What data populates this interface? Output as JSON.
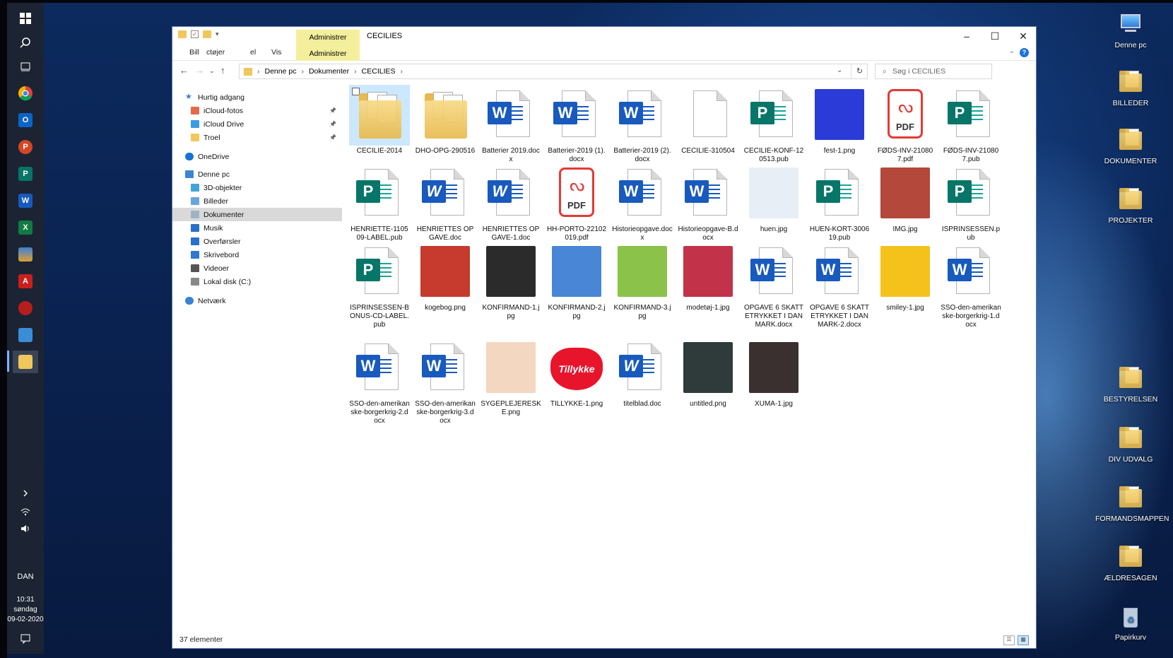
{
  "window": {
    "title": "CECILIES",
    "context_tab_top": "Administrer",
    "context_tab_bottom": "Administrer",
    "ribbon_tabs": [
      "Bill",
      "ctøjer",
      "el",
      "Vis"
    ]
  },
  "address": {
    "path": [
      "Denne pc",
      "Dokumenter",
      "CECILIES"
    ],
    "search_placeholder": "Søg i CECILIES"
  },
  "navpane": {
    "items": [
      {
        "label": "Hurtig adgang",
        "icon": "star-icon",
        "pinned": false
      },
      {
        "label": "iCloud-fotos",
        "icon": "icloud-photos-icon",
        "pinned": true
      },
      {
        "label": "iCloud Drive",
        "icon": "icloud-drive-icon",
        "pinned": true
      },
      {
        "label": "Troel",
        "icon": "folder-icon",
        "pinned": true
      },
      {
        "label": "OneDrive",
        "icon": "onedrive-icon",
        "pinned": false
      },
      {
        "label": "Denne pc",
        "icon": "computer-icon",
        "pinned": false
      },
      {
        "label": "3D-objekter",
        "icon": "cube-icon",
        "pinned": false
      },
      {
        "label": "Billeder",
        "icon": "pictures-icon",
        "pinned": false
      },
      {
        "label": "Dokumenter",
        "icon": "documents-icon",
        "pinned": false,
        "selected": true
      },
      {
        "label": "Musik",
        "icon": "music-icon",
        "pinned": false
      },
      {
        "label": "Overførsler",
        "icon": "download-icon",
        "pinned": false
      },
      {
        "label": "Skrivebord",
        "icon": "desktop-icon",
        "pinned": false
      },
      {
        "label": "Videoer",
        "icon": "video-icon",
        "pinned": false
      },
      {
        "label": "Lokal disk (C:)",
        "icon": "disk-icon",
        "pinned": false
      },
      {
        "label": "Netværk",
        "icon": "network-icon",
        "pinned": false
      }
    ]
  },
  "files": [
    {
      "name": "CECILIE-2014",
      "type": "folder",
      "selected": true
    },
    {
      "name": "DHO-OPG-290516",
      "type": "folder"
    },
    {
      "name": "Batterier 2019.docx",
      "type": "word"
    },
    {
      "name": "Batterier-2019 (1).docx",
      "type": "word"
    },
    {
      "name": "Batterier-2019 (2).docx",
      "type": "word"
    },
    {
      "name": "CECILIE-310504",
      "type": "blank"
    },
    {
      "name": "CECILIE-KONF-120513.pub",
      "type": "pub"
    },
    {
      "name": "fest-1.png",
      "type": "image",
      "color": "#2a3bd8"
    },
    {
      "name": "FØDS-INV-210807.pdf",
      "type": "pdf"
    },
    {
      "name": "FØDS-INV-210807.pub",
      "type": "pub"
    },
    {
      "name": "HENRIETTE-110509-LABEL.pub",
      "type": "pub"
    },
    {
      "name": "HENRIETTES OPGAVE.doc",
      "type": "word-old"
    },
    {
      "name": "HENRIETTES OPGAVE-1.doc",
      "type": "word-old"
    },
    {
      "name": "HH-PORTO-22102019.pdf",
      "type": "pdf"
    },
    {
      "name": "Historieopgave.docx",
      "type": "word"
    },
    {
      "name": "Historieopgave-B.docx",
      "type": "word"
    },
    {
      "name": "huen.jpg",
      "type": "image",
      "color": "#e8eef5"
    },
    {
      "name": "HUEN-KORT-300619.pub",
      "type": "pub"
    },
    {
      "name": "IMG.jpg",
      "type": "image",
      "color": "#b4483a"
    },
    {
      "name": "ISPRINSESSEN.pub",
      "type": "pub"
    },
    {
      "name": "ISPRINSESSEN-BONUS-CD-LABEL.pub",
      "type": "pub"
    },
    {
      "name": "kogebog.png",
      "type": "image",
      "color": "#c73a2e"
    },
    {
      "name": "KONFIRMAND-1.jpg",
      "type": "image",
      "color": "#2b2b2b"
    },
    {
      "name": "KONFIRMAND-2.jpg",
      "type": "image",
      "color": "#4a86d6"
    },
    {
      "name": "KONFIRMAND-3.jpg",
      "type": "image",
      "color": "#8ac24a"
    },
    {
      "name": "modetøj-1.jpg",
      "type": "image",
      "color": "#c2334a"
    },
    {
      "name": "OPGAVE 6 SKATTETRYKKET I DANMARK.docx",
      "type": "word"
    },
    {
      "name": "OPGAVE 6 SKATTETRYKKET I DANMARK-2.docx",
      "type": "word"
    },
    {
      "name": "smiley-1.jpg",
      "type": "image",
      "color": "#f5c21b"
    },
    {
      "name": "SSO-den-amerikanske-borgerkrig-1.docx",
      "type": "word"
    },
    {
      "name": "SSO-den-amerikanske-borgerkrig-2.docx",
      "type": "word"
    },
    {
      "name": "SSO-den-amerikanske-borgerkrig-3.docx",
      "type": "word"
    },
    {
      "name": "SYGEPLEJERESKE.png",
      "type": "image",
      "color": "#f3d7c0"
    },
    {
      "name": "TILLYKKE-1.png",
      "type": "image",
      "color": "#e8142b",
      "label": "Tillykke"
    },
    {
      "name": "titelblad.doc",
      "type": "word-old"
    },
    {
      "name": "untitled.png",
      "type": "image",
      "color": "#2e3b3a"
    },
    {
      "name": "XUMA-1.jpg",
      "type": "image",
      "color": "#3a3030"
    }
  ],
  "status": {
    "count_text": "37 elementer"
  },
  "desktop_icons": [
    {
      "label": "Denne pc",
      "icon": "computer-icon"
    },
    {
      "label": "BILLEDER",
      "icon": "folder-icon"
    },
    {
      "label": "DOKUMENTER",
      "icon": "folder-icon"
    },
    {
      "label": "PROJEKTER",
      "icon": "folder-icon"
    },
    {
      "label": "BESTYRELSEN",
      "icon": "folder-icon"
    },
    {
      "label": "DIV UDVALG",
      "icon": "folder-icon"
    },
    {
      "label": "FORMANDSMAPPEN",
      "icon": "folder-icon"
    },
    {
      "label": "ÆLDRESAGEN",
      "icon": "folder-icon"
    },
    {
      "label": "Papirkurv",
      "icon": "recycle-bin-icon"
    }
  ],
  "taskbar": {
    "language": "DAN",
    "time": "10:31",
    "day": "søndag",
    "date": "09-02-2020"
  },
  "colors": {
    "word": "#185abd",
    "publisher": "#077568",
    "pdf": "#e53935",
    "folder": "#f0c75a",
    "selection": "#cce8ff"
  }
}
